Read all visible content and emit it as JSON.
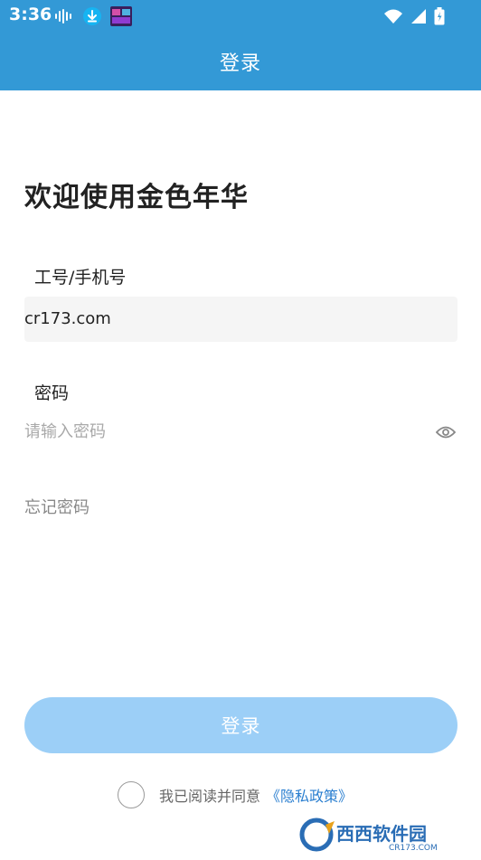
{
  "status_bar": {
    "time": "3:36",
    "icons": [
      "audio-waves-icon",
      "download-icon",
      "app-thumbnail-icon",
      "wifi-icon",
      "signal-icon",
      "battery-icon"
    ]
  },
  "app_bar": {
    "title": "登录"
  },
  "welcome": "欢迎使用金色年华",
  "account": {
    "label": "工号/手机号",
    "value": "cr173.com"
  },
  "password": {
    "label": "密码",
    "placeholder": "请输入密码",
    "value": ""
  },
  "forgot_password": "忘记密码",
  "login_button": "登录",
  "agreement": {
    "text": "我已阅读并同意",
    "link": "《隐私政策》",
    "checked": false
  },
  "watermark": {
    "text": "西西软件园",
    "subtext": "CR173.COM"
  },
  "colors": {
    "primary": "#3399d6",
    "button_disabled": "#9ccff7",
    "link": "#2b7fd0"
  }
}
